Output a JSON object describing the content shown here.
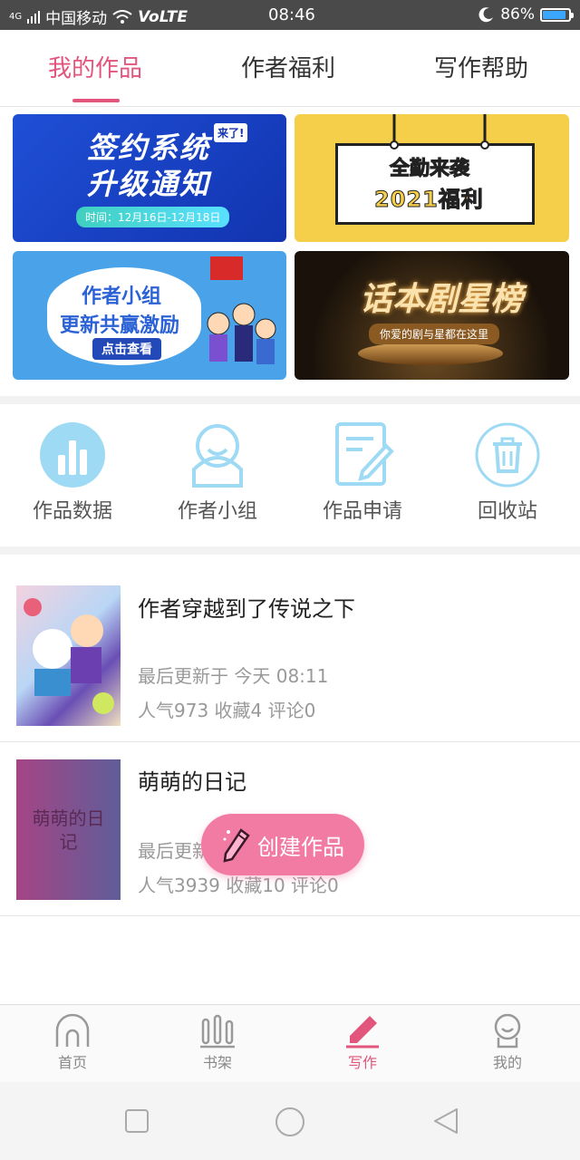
{
  "status_bar": {
    "network": "4G",
    "carrier": "中国移动",
    "volte": "VoLTE",
    "time": "08:46",
    "battery": "86%"
  },
  "tabs": [
    {
      "label": "我的作品",
      "active": true
    },
    {
      "label": "作者福利",
      "active": false
    },
    {
      "label": "写作帮助",
      "active": false
    }
  ],
  "banners": {
    "b1": {
      "line1": "签约系统",
      "line2": "升级通知",
      "tag": "来了!",
      "date": "时间：12月16日-12月18日"
    },
    "b2": {
      "line1": "全勤来袭",
      "line2": "2021福利"
    },
    "b3": {
      "line1": "作者小组",
      "line2": "更新共赢激励",
      "button": "点击查看"
    },
    "b4": {
      "line1": "话本剧星榜",
      "line2": "你爱的剧与星都在这里"
    }
  },
  "quick_actions": [
    {
      "label": "作品数据",
      "icon": "bar-chart-icon"
    },
    {
      "label": "作者小组",
      "icon": "group-icon"
    },
    {
      "label": "作品申请",
      "icon": "apply-edit-icon"
    },
    {
      "label": "回收站",
      "icon": "trash-icon"
    }
  ],
  "works": [
    {
      "title": "作者穿越到了传说之下",
      "updated": "最后更新于 今天 08:11",
      "stats": "人气973  收藏4  评论0",
      "cover_text": ""
    },
    {
      "title": "萌萌的日记",
      "updated": "最后更新于 今天 08:11",
      "stats": "人气3939  收藏10  评论0",
      "cover_text": "萌萌的日记"
    }
  ],
  "fab": {
    "label": "创建作品",
    "icon": "pencil-icon"
  },
  "bottom_nav": [
    {
      "label": "首页",
      "icon": "home-icon",
      "active": false
    },
    {
      "label": "书架",
      "icon": "bookshelf-icon",
      "active": false
    },
    {
      "label": "写作",
      "icon": "pen-icon",
      "active": true
    },
    {
      "label": "我的",
      "icon": "profile-icon",
      "active": false
    }
  ],
  "colors": {
    "accent": "#e2557d",
    "fab": "#f27ba4",
    "icon_blue": "#8fd0f0"
  }
}
